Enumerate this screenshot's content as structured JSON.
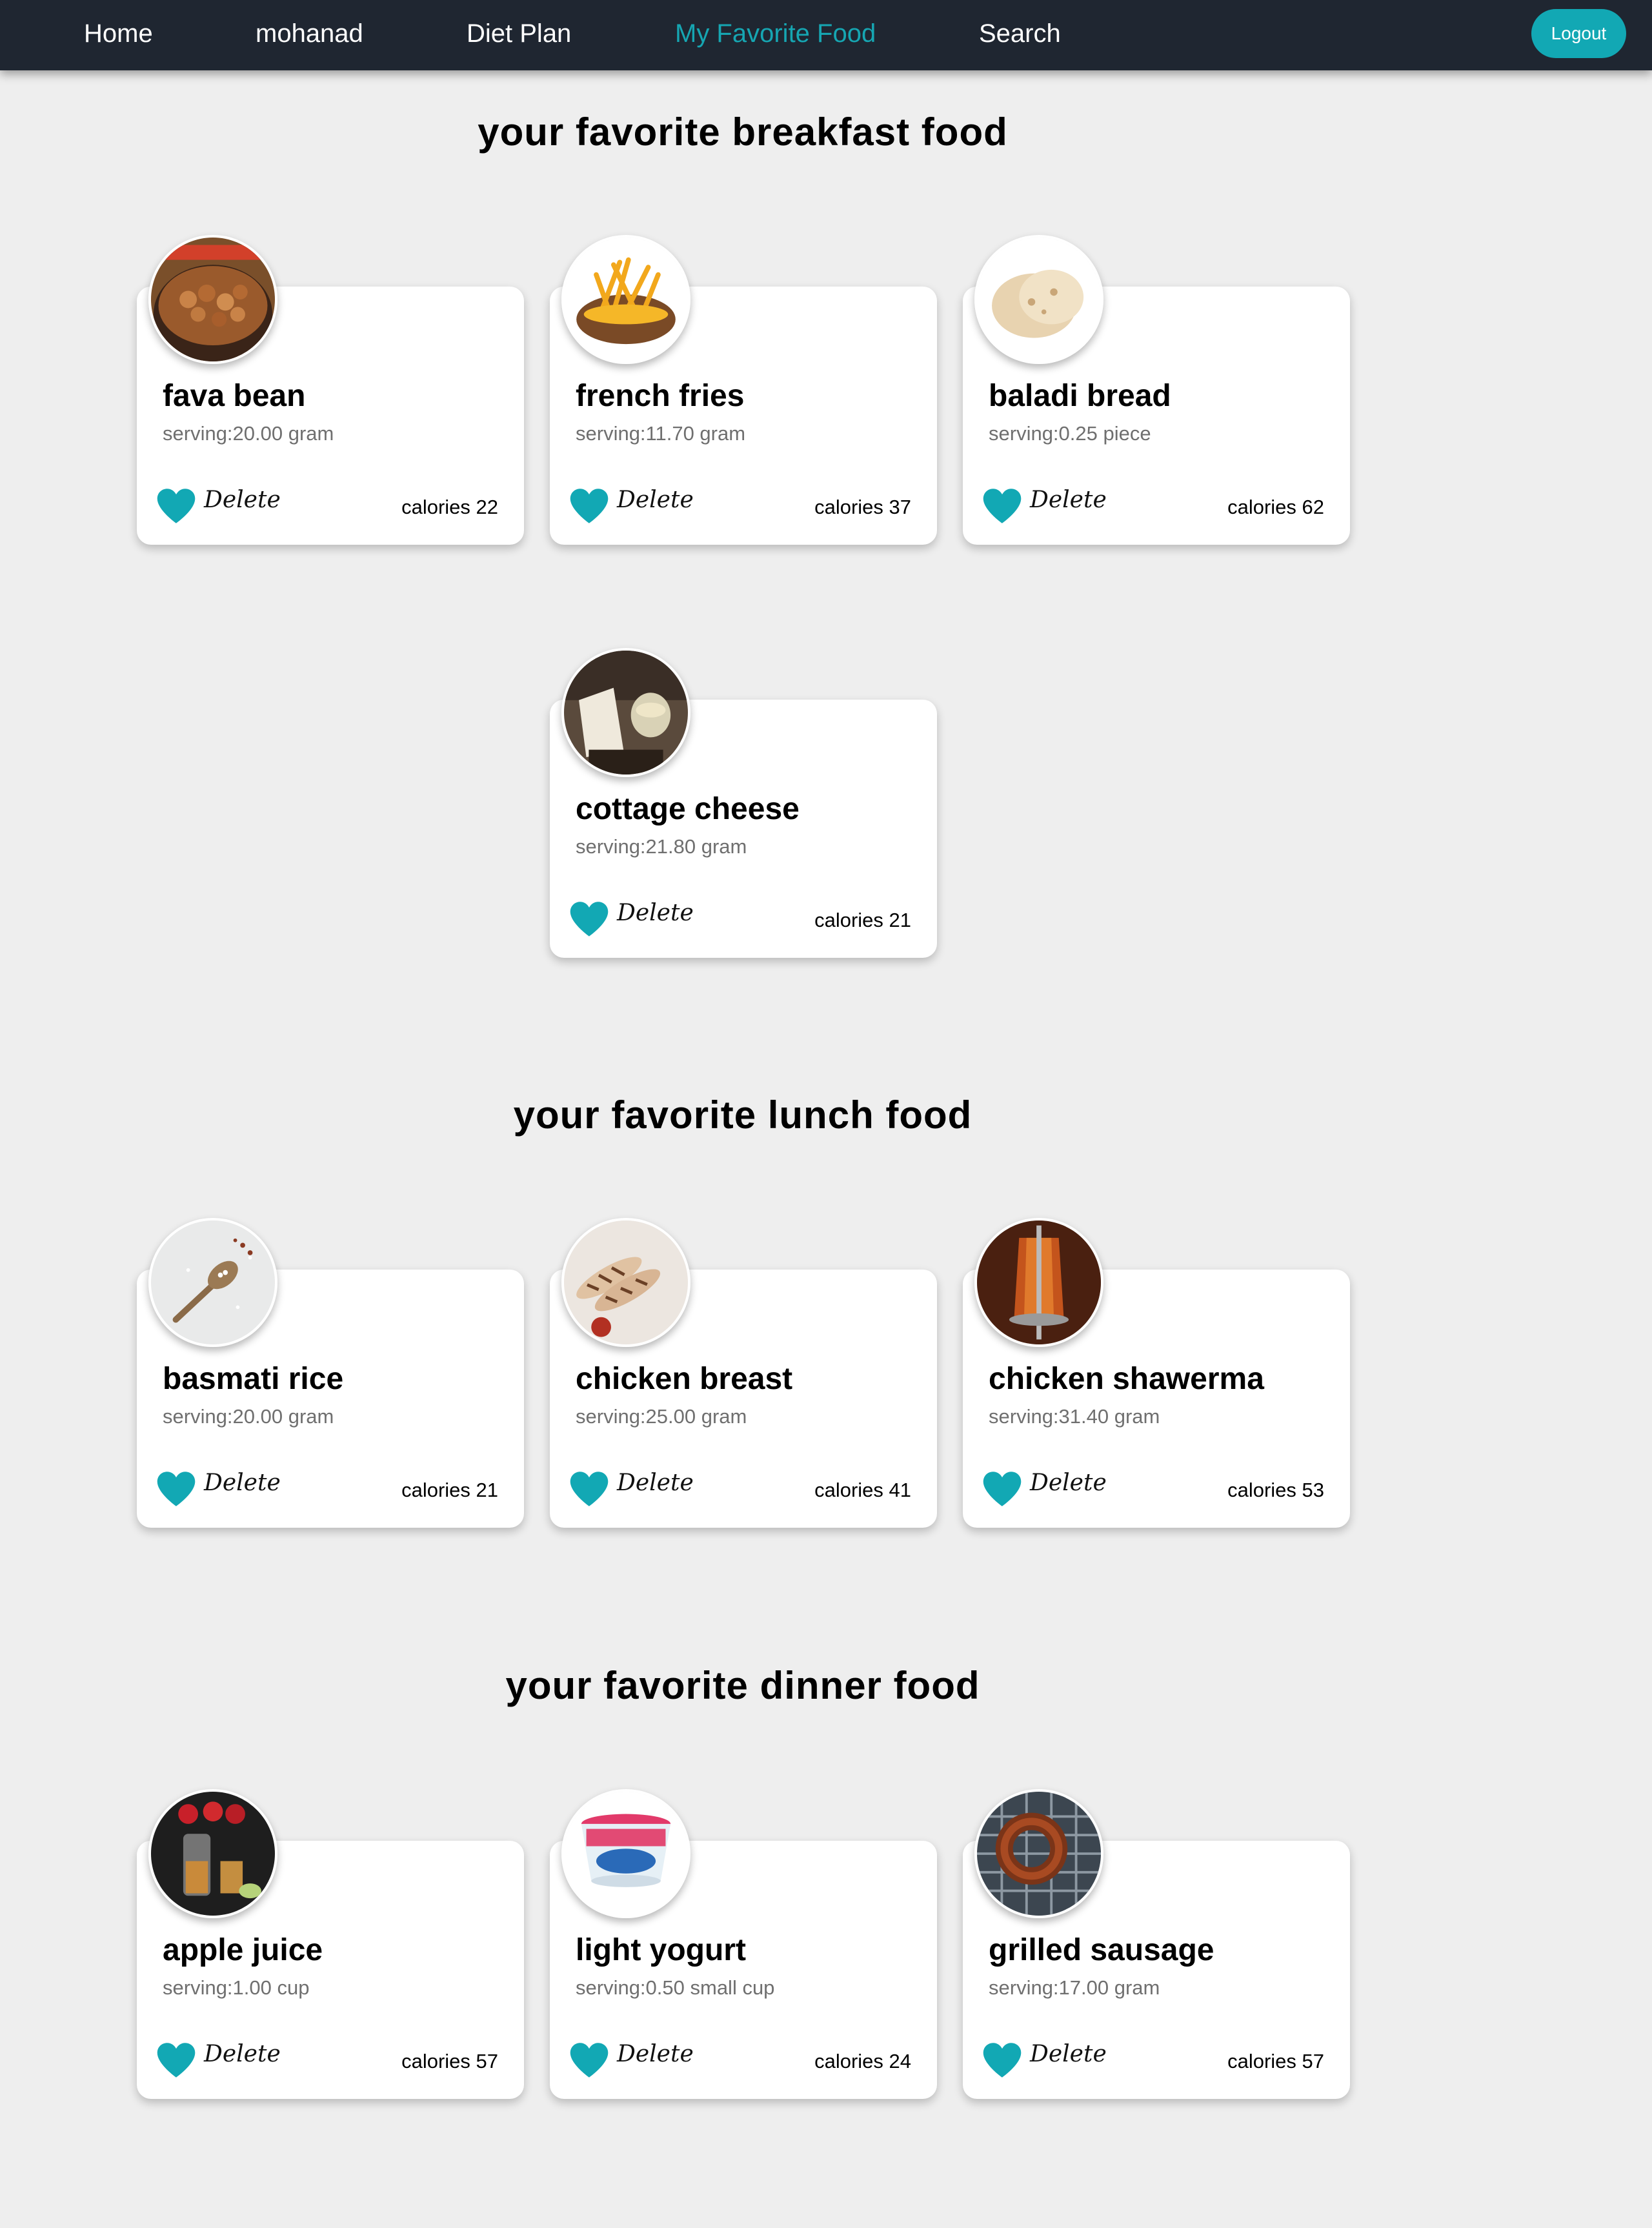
{
  "nav": {
    "links": [
      "Home",
      "mohanad",
      "Diet Plan",
      "My Favorite Food",
      "Search"
    ],
    "active": "My Favorite Food",
    "logout_label": "Logout"
  },
  "sections": {
    "breakfast": {
      "title": "your favorite breakfast food",
      "items": [
        {
          "name": "fava bean",
          "serving": "serving:20.00 gram",
          "delete_label": "Delete",
          "calories": "calories 22",
          "image": "fava-bean"
        },
        {
          "name": "french fries",
          "serving": "serving:11.70 gram",
          "delete_label": "Delete",
          "calories": "calories 37",
          "image": "french-fries"
        },
        {
          "name": "baladi bread",
          "serving": "serving:0.25 piece",
          "delete_label": "Delete",
          "calories": "calories 62",
          "image": "baladi-bread"
        },
        {
          "name": "cottage cheese",
          "serving": "serving:21.80 gram",
          "delete_label": "Delete",
          "calories": "calories 21",
          "image": "cottage-cheese"
        }
      ]
    },
    "lunch": {
      "title": "your favorite lunch food",
      "items": [
        {
          "name": "basmati rice",
          "serving": "serving:20.00 gram",
          "delete_label": "Delete",
          "calories": "calories 21",
          "image": "basmati-rice"
        },
        {
          "name": "chicken breast",
          "serving": "serving:25.00 gram",
          "delete_label": "Delete",
          "calories": "calories 41",
          "image": "chicken-breast"
        },
        {
          "name": "chicken shawerma",
          "serving": "serving:31.40 gram",
          "delete_label": "Delete",
          "calories": "calories 53",
          "image": "chicken-shawerma"
        }
      ]
    },
    "dinner": {
      "title": "your favorite dinner food",
      "items": [
        {
          "name": "apple juice",
          "serving": "serving:1.00 cup",
          "delete_label": "Delete",
          "calories": "calories 57",
          "image": "apple-juice"
        },
        {
          "name": "light yogurt",
          "serving": "serving:0.50 small cup",
          "delete_label": "Delete",
          "calories": "calories 24",
          "image": "light-yogurt"
        },
        {
          "name": "grilled sausage",
          "serving": "serving:17.00 gram",
          "delete_label": "Delete",
          "calories": "calories 57",
          "image": "grilled-sausage"
        }
      ]
    }
  },
  "colors": {
    "accent": "#16a6b2",
    "navbar": "#1f2631",
    "background": "#eeeeee",
    "heart": "#12a8b4"
  }
}
